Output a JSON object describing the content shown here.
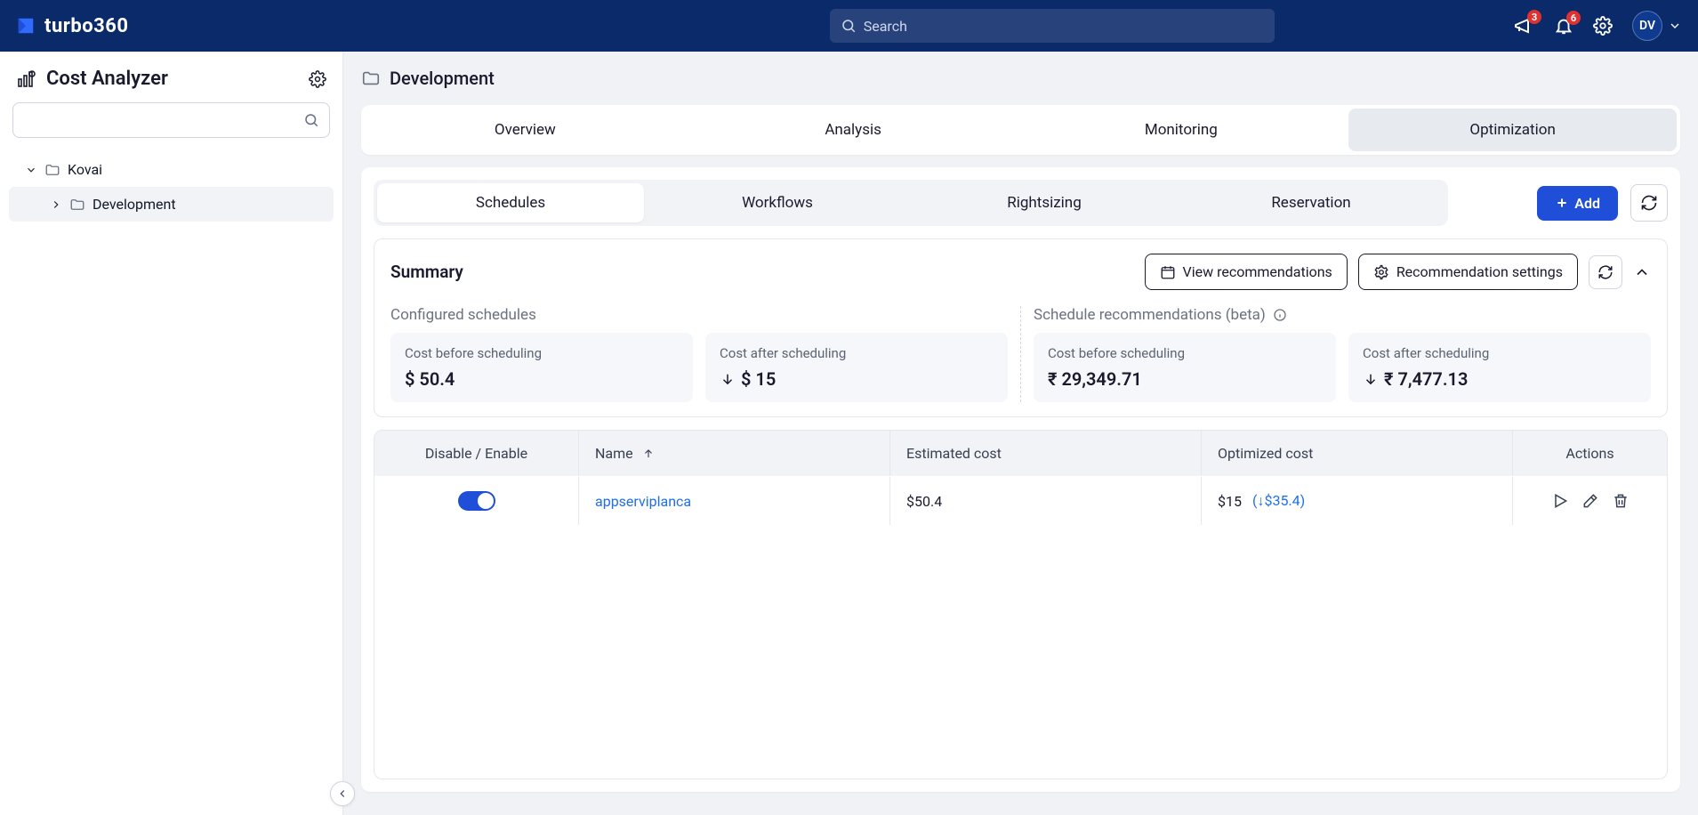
{
  "brand": "turbo360",
  "search": {
    "placeholder": "Search"
  },
  "notifications": {
    "announcements": "3",
    "alerts": "6"
  },
  "user": {
    "initials": "DV"
  },
  "sidebar": {
    "title": "Cost Analyzer",
    "tree": {
      "root": "Kovai",
      "child": "Development"
    }
  },
  "breadcrumb": {
    "title": "Development"
  },
  "tabs": [
    "Overview",
    "Analysis",
    "Monitoring",
    "Optimization"
  ],
  "activeTab": "Optimization",
  "subtabs": [
    "Schedules",
    "Workflows",
    "Rightsizing",
    "Reservation"
  ],
  "activeSubtab": "Schedules",
  "buttons": {
    "add": "Add",
    "viewRecommendations": "View recommendations",
    "recommendationSettings": "Recommendation settings"
  },
  "summary": {
    "title": "Summary",
    "left": {
      "title": "Configured schedules",
      "cards": [
        {
          "label": "Cost before scheduling",
          "value": "$ 50.4"
        },
        {
          "label": "Cost after scheduling",
          "value": "$ 15"
        }
      ]
    },
    "right": {
      "title": "Schedule recommendations (beta)",
      "cards": [
        {
          "label": "Cost before scheduling",
          "value": "₹ 29,349.71"
        },
        {
          "label": "Cost after scheduling",
          "value": "₹ 7,477.13"
        }
      ]
    }
  },
  "table": {
    "headers": {
      "toggle": "Disable / Enable",
      "name": "Name",
      "est": "Estimated cost",
      "opt": "Optimized cost",
      "actions": "Actions"
    },
    "rows": [
      {
        "name": "appserviplanca",
        "est": "$50.4",
        "opt": "$15",
        "savings": "(↓$35.4)"
      }
    ]
  }
}
